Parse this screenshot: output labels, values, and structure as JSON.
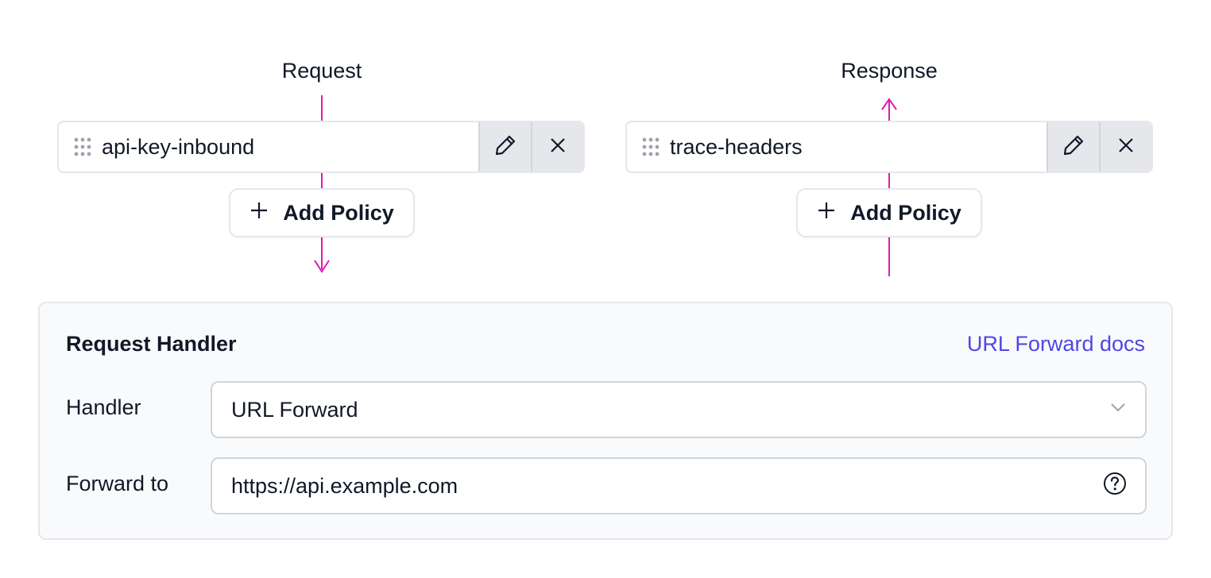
{
  "request_flow": {
    "label": "Request",
    "policy": {
      "name": "api-key-inbound",
      "drag_icon": "drag-handle-icon",
      "edit_icon": "pencil-icon",
      "remove_icon": "x-icon"
    },
    "add_policy": {
      "icon": "plus-icon",
      "label": "Add Policy"
    }
  },
  "response_flow": {
    "label": "Response",
    "policy": {
      "name": "trace-headers",
      "drag_icon": "drag-handle-icon",
      "edit_icon": "pencil-icon",
      "remove_icon": "x-icon"
    },
    "add_policy": {
      "icon": "plus-icon",
      "label": "Add Policy"
    }
  },
  "request_handler": {
    "title": "Request Handler",
    "docs_link": "URL Forward docs",
    "handler": {
      "label": "Handler",
      "value": "URL Forward"
    },
    "forward_to": {
      "label": "Forward to",
      "value": "https://api.example.com"
    }
  },
  "colors": {
    "flow_line": "#e018b4",
    "link": "#4f46e5",
    "button_bg": "#e5e7eb"
  }
}
